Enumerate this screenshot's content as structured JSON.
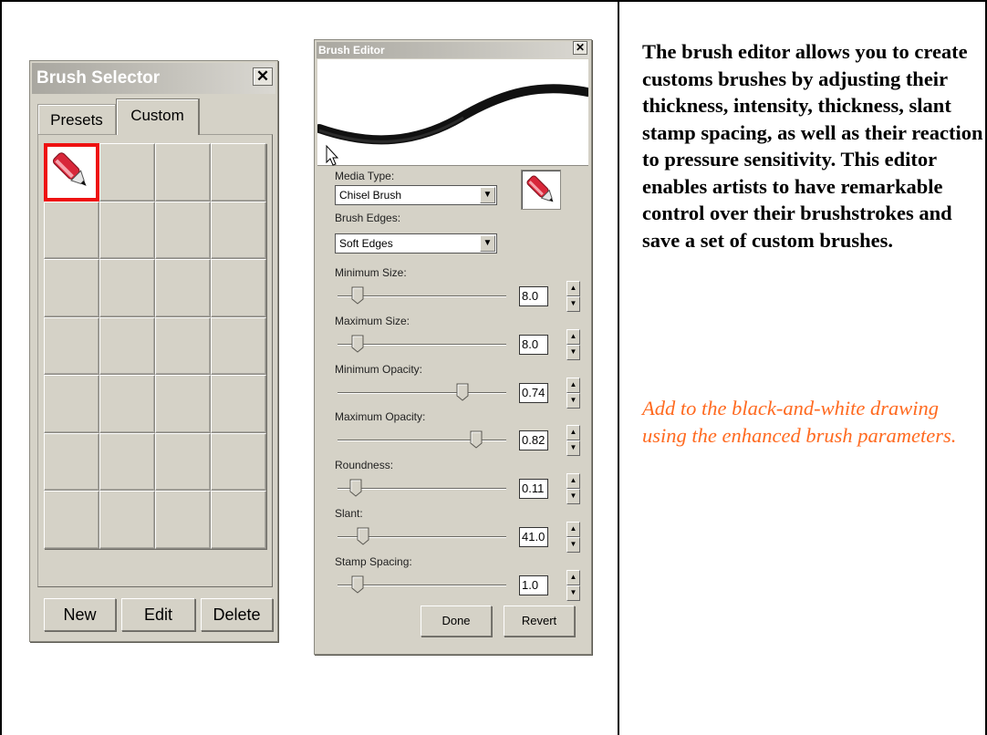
{
  "brush_selector": {
    "title": "Brush Selector",
    "close_glyph": "✕",
    "tabs": [
      {
        "label": "Presets",
        "active": false
      },
      {
        "label": "Custom",
        "active": true
      }
    ],
    "grid": {
      "rows": 7,
      "columns": 4,
      "selected_index": 0,
      "selected_icon": "pen-brush-icon"
    },
    "buttons": {
      "new": "New",
      "edit": "Edit",
      "delete": "Delete"
    }
  },
  "brush_editor": {
    "title": "Brush Editor",
    "close_glyph": "✕",
    "preview_icon": "cursor-arrow-icon",
    "media_type": {
      "label": "Media Type:",
      "value": "Chisel Brush"
    },
    "brush_edges": {
      "label": "Brush Edges:",
      "value": "Soft Edges"
    },
    "brush_icon": "pen-brush-icon",
    "sliders": [
      {
        "label": "Minimum Size:",
        "value": "8.0",
        "level": 0.12
      },
      {
        "label": "Maximum Size:",
        "value": "8.0",
        "level": 0.12
      },
      {
        "label": "Minimum Opacity:",
        "value": "0.74",
        "level": 0.74
      },
      {
        "label": "Maximum Opacity:",
        "value": "0.82",
        "level": 0.82
      },
      {
        "label": "Roundness:",
        "value": "0.11",
        "level": 0.11
      },
      {
        "label": "Slant:",
        "value": "41.0",
        "level": 0.15
      },
      {
        "label": "Stamp Spacing:",
        "value": "1.0",
        "level": 0.12
      }
    ],
    "buttons": {
      "done": "Done",
      "revert": "Revert"
    }
  },
  "description": "The brush editor allows you to create customs brushes by adjusting their thickness, intensity, thickness, slant stamp spacing, as well as their reaction to pressure sensitivity. This editor enables artists to have remarkable control over their brushstrokes and save a set of custom brushes.",
  "instruction": "Add to the black-and-white drawing using the enhanced brush parameters.",
  "colors": {
    "instruction_text": "#ff6a20",
    "selection_border": "#ee1111",
    "window_face": "#d5d2c7"
  }
}
